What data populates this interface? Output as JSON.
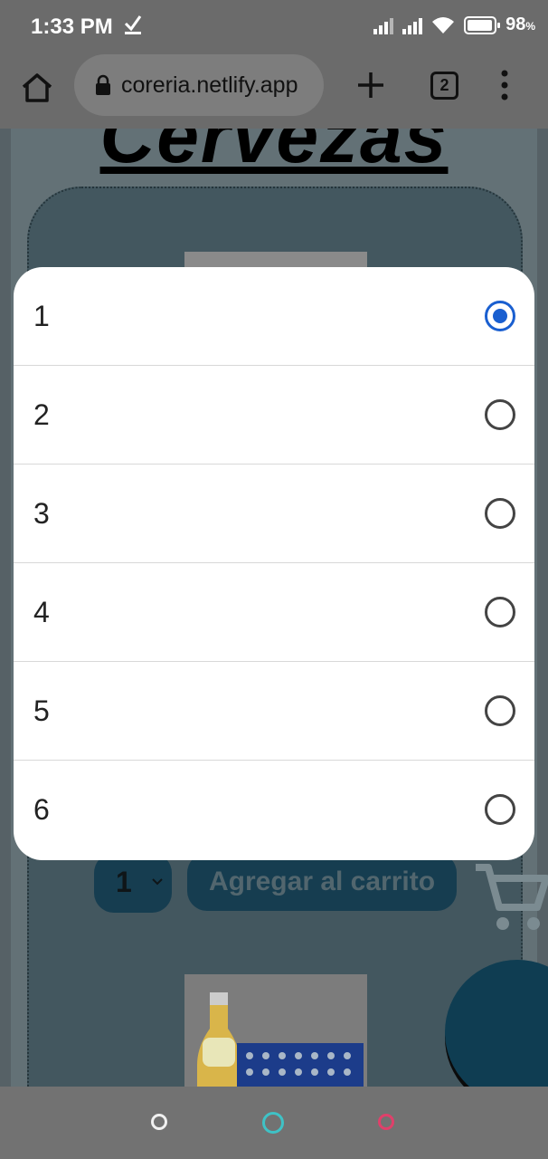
{
  "status_bar": {
    "time": "1:33 PM",
    "download_icon": "download-done-icon",
    "battery": "98",
    "battery_unit": "%"
  },
  "browser": {
    "url": "coreria.netlify.app",
    "tab_count": "2",
    "icons": [
      "home-icon",
      "lock-icon",
      "plus-icon",
      "tabs-icon",
      "more-vert-icon"
    ]
  },
  "page": {
    "title": "Cervezas",
    "quantity_value": "1",
    "add_to_cart_label": "Agregar al carrito",
    "cart_icon": "shopping-cart-icon"
  },
  "dropdown": {
    "options": [
      {
        "label": "1",
        "selected": true
      },
      {
        "label": "2",
        "selected": false
      },
      {
        "label": "3",
        "selected": false
      },
      {
        "label": "4",
        "selected": false
      },
      {
        "label": "5",
        "selected": false
      },
      {
        "label": "6",
        "selected": false
      }
    ],
    "accent_color": "#1a5fd0"
  },
  "nav_bar": {
    "colors": {
      "home": "#f0f0f0",
      "recents": "#3fc2c6",
      "back": "#e0406a"
    }
  }
}
